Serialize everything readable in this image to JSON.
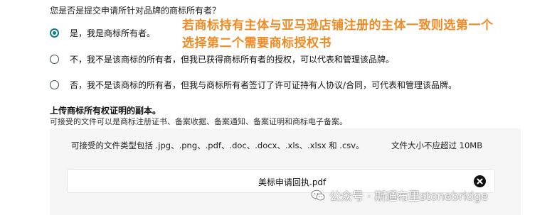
{
  "question": {
    "text": "您是否是提交申请所针对品牌的商标所有者？"
  },
  "options": [
    {
      "label": "是，我是商标所有者。",
      "selected": true
    },
    {
      "label": "不，我不是该商标的所有者，但我已获得商标所有者的授权，可以代表和管理该品牌。",
      "selected": false
    },
    {
      "label": "否，我不是该商标的所有者，但我与商标所有者签订了许可证持有人协议/合同，可代表和管理该品牌。",
      "selected": false
    }
  ],
  "annotation": {
    "line1": "若商标持有主体与亚马逊店铺注册的主体一致则选第一个",
    "line2": "选择第二个需要商标授权书",
    "color": "#f08a24"
  },
  "upload": {
    "title": "上传商标所有权证明的副本。",
    "description": "可接受的文件可以是商标注册证书、备案收据、备案通知、备案证明和商标电子备案。",
    "accepted_types": "可接受的文件类型包括 .jpg、.png、.pdf、.doc、.docx、.xls、.xlsx 和 .csv。",
    "max_size": "文件大小不应超过 10MB",
    "file": {
      "name": "美标申请回执.pdf",
      "remove_icon": "close-circle-icon"
    }
  },
  "watermark": {
    "icon": "wechat-icon",
    "text": "公众号 · 斯通布里stonebridge"
  },
  "colors": {
    "radio_selected": "#0f7c88",
    "panel_bg": "#f5f5f6"
  }
}
